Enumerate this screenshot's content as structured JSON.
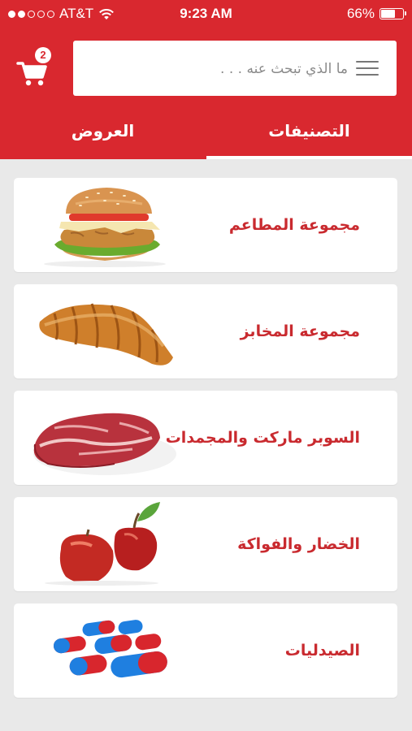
{
  "status_bar": {
    "carrier": "AT&T",
    "time": "9:23 AM",
    "battery": "66%",
    "battery_level": 0.66,
    "signal_bars_filled": 2,
    "signal_bars_total": 5
  },
  "header": {
    "cart_count": "2",
    "search_placeholder": "ما الذي تبحث عنه . . .",
    "cart_icon": "shopping-cart-icon",
    "menu_icon": "hamburger-menu-icon"
  },
  "tabs": {
    "categories": "التصنيفات",
    "offers": "العروض",
    "active": "categories"
  },
  "categories": [
    {
      "label": "مجموعة المطاعم",
      "icon": "burger-image"
    },
    {
      "label": "مجموعة المخابز",
      "icon": "croissant-image"
    },
    {
      "label": "السوبر ماركت والمجمدات",
      "icon": "meat-image"
    },
    {
      "label": "الخضار والفواكة",
      "icon": "apples-image"
    },
    {
      "label": "الصيدليات",
      "icon": "pills-image"
    }
  ],
  "colors": {
    "brand_red": "#d9282f",
    "label_red": "#c92a2f",
    "background": "#e9e9e9"
  }
}
